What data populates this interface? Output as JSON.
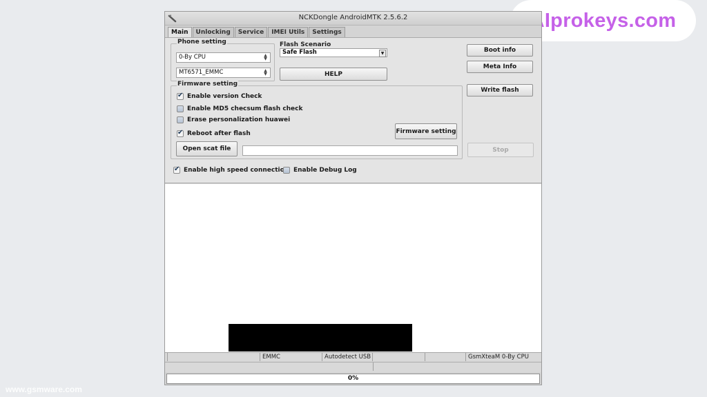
{
  "window": {
    "title": "NCKDongle AndroidMTK 2.5.6.2"
  },
  "tabs": [
    {
      "label": "Main",
      "active": true
    },
    {
      "label": "Unlocking"
    },
    {
      "label": "Service"
    },
    {
      "label": "IMEI Utils"
    },
    {
      "label": "Settings"
    }
  ],
  "phone_setting": {
    "label": "Phone setting",
    "cpu_select": "0-By CPU",
    "chip_select": "MT6571_EMMC"
  },
  "flash_scenario": {
    "label": "Flash Scenario",
    "value": "Safe Flash"
  },
  "buttons": {
    "help": "HELP",
    "boot_info": "Boot info",
    "meta_info": "Meta Info",
    "write_flash": "Write flash",
    "stop": "Stop",
    "firmware_setting": "Firmware setting",
    "open_scat": "Open scat file"
  },
  "firmware_setting": {
    "label": "Firmware setting",
    "options": [
      {
        "label": "Enable version Check",
        "checked": true
      },
      {
        "label": "Enable MD5 checsum flash check",
        "checked": false
      },
      {
        "label": "Erase personalization huawei",
        "checked": false
      },
      {
        "label": "Reboot after flash",
        "checked": true
      }
    ],
    "scat_path": ""
  },
  "bottom_options": [
    {
      "label": "Enable high speed connection",
      "checked": true
    },
    {
      "label": "Enable Debug Log",
      "checked": false
    }
  ],
  "status_bar": {
    "cells": [
      "",
      "",
      "EMMC",
      "Autodetect USB",
      "",
      "",
      "GsmXteaM 0-By CPU"
    ]
  },
  "progress": {
    "value": 0,
    "text": "0%"
  },
  "watermarks": {
    "top_right": "AIprokeys.com",
    "bottom_left": "www.gsmware.com"
  },
  "colors": {
    "watermark": "#c561e8",
    "window_bg": "#e4e4e4"
  }
}
